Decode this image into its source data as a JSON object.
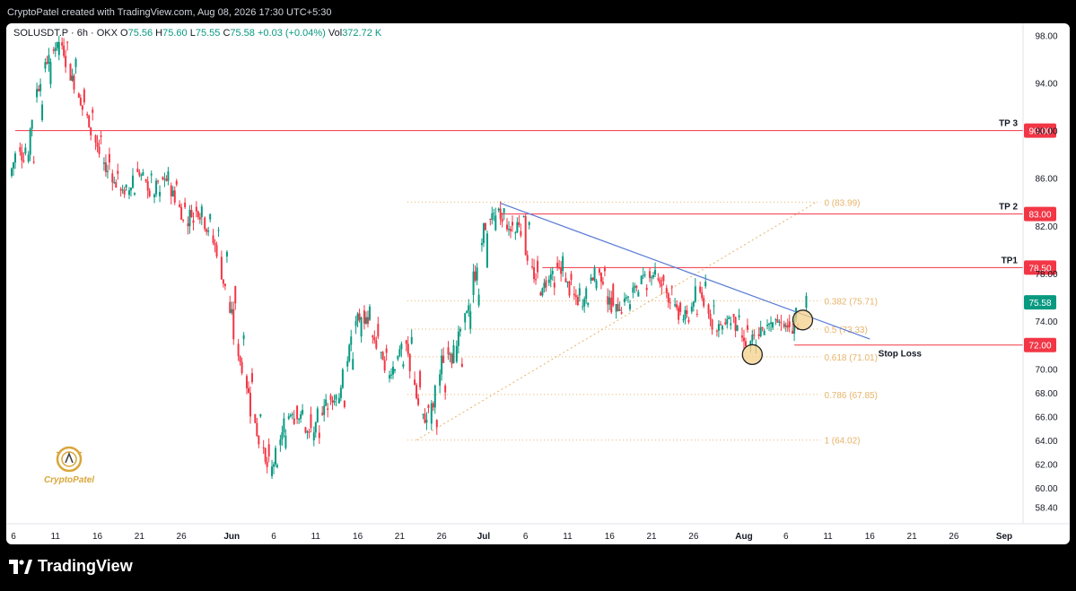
{
  "header": {
    "credit": "CryptoPatel created with TradingView.com, Aug 08, 2026 17:30 UTC+5:30"
  },
  "legend": {
    "symbol": "SOLUSDT.P · 6h · OKX",
    "open_label": "O",
    "open": "75.56",
    "high_label": "H",
    "high": "75.60",
    "low_label": "L",
    "low": "75.55",
    "close_label": "C",
    "close": "75.58",
    "change": "+0.03 (+0.04%)",
    "vol_label": "Vol",
    "vol": "372.72 K"
  },
  "watermark": {
    "text": "CryptoPatel"
  },
  "footer": {
    "brand": "TradingView"
  },
  "colors": {
    "up": "#089981",
    "down": "#f23645",
    "level": "#f23645",
    "trendline": "#5b7bd5",
    "fib": "#e6b36a",
    "marker_fill": "#f5d08a",
    "marker_stroke": "#222222"
  },
  "chart_data": {
    "type": "candlestick",
    "ylim": [
      57,
      99
    ],
    "y_ticks": [
      "98.00",
      "94.00",
      "90.00",
      "86.00",
      "82.00",
      "78.00",
      "74.00",
      "70.00",
      "68.00",
      "66.00",
      "64.00",
      "62.00",
      "60.00",
      "58.40"
    ],
    "y_tick_values": [
      98,
      94,
      90,
      86,
      82,
      78,
      74,
      70,
      68,
      66,
      64,
      62,
      60,
      58.4
    ],
    "x_ticks": [
      "6",
      "11",
      "16",
      "21",
      "26",
      "Jun",
      "6",
      "11",
      "16",
      "21",
      "26",
      "Jul",
      "6",
      "11",
      "16",
      "21",
      "26",
      "Aug",
      "6",
      "11",
      "16",
      "21",
      "26",
      "Sep"
    ],
    "x_start": "2026-05-06",
    "x_end": "2026-09-01",
    "last_price": "75.58",
    "levels": [
      {
        "label": "TP 3",
        "value": 90.0,
        "tag": "90.00"
      },
      {
        "label": "TP 2",
        "value": 83.0,
        "tag": "83.00"
      },
      {
        "label": "TP1",
        "value": 78.5,
        "tag": "78.50"
      },
      {
        "label": "Stop Loss",
        "value": 72.0,
        "tag": "72.00"
      }
    ],
    "fib": [
      {
        "ratio": "0",
        "price": "83.99",
        "label": "0 (83.99)",
        "value": 83.99
      },
      {
        "ratio": "0.382",
        "price": "75.71",
        "label": "0.382 (75.71)",
        "value": 75.71
      },
      {
        "ratio": "0.5",
        "price": "73.33",
        "label": "0.5 (73.33)",
        "value": 73.33
      },
      {
        "ratio": "0.618",
        "price": "71.01",
        "label": "0.618 (71.01)",
        "value": 71.01
      },
      {
        "ratio": "0.786",
        "price": "67.85",
        "label": "0.786 (67.85)",
        "value": 67.85
      },
      {
        "ratio": "1",
        "price": "64.02",
        "label": "1 (64.02)",
        "value": 64.02
      }
    ],
    "fib_range": {
      "from_date": "2026-06-23",
      "to_date": "2026-08-08",
      "low": 64.02,
      "high": 83.99
    },
    "trendline": {
      "from_date": "2026-07-03",
      "from_value": 83.9,
      "to_date": "2026-08-16",
      "to_value": 72.5
    },
    "markers": [
      {
        "date": "2026-08-02",
        "value": 71.2
      },
      {
        "date": "2026-08-08",
        "value": 74.1
      }
    ],
    "series_daily_close": [
      {
        "date": "2026-05-06",
        "value": 86.2
      },
      {
        "date": "2026-05-07",
        "value": 88.6
      },
      {
        "date": "2026-05-08",
        "value": 87.4
      },
      {
        "date": "2026-05-09",
        "value": 92.8
      },
      {
        "date": "2026-05-10",
        "value": 95.2
      },
      {
        "date": "2026-05-11",
        "value": 96.8
      },
      {
        "date": "2026-05-12",
        "value": 97.4
      },
      {
        "date": "2026-05-13",
        "value": 95.6
      },
      {
        "date": "2026-05-14",
        "value": 93.1
      },
      {
        "date": "2026-05-15",
        "value": 91.4
      },
      {
        "date": "2026-05-16",
        "value": 89.6
      },
      {
        "date": "2026-05-17",
        "value": 87.2
      },
      {
        "date": "2026-05-18",
        "value": 86.4
      },
      {
        "date": "2026-05-19",
        "value": 85.1
      },
      {
        "date": "2026-05-20",
        "value": 84.6
      },
      {
        "date": "2026-05-21",
        "value": 86.8
      },
      {
        "date": "2026-05-22",
        "value": 85.9
      },
      {
        "date": "2026-05-23",
        "value": 84.4
      },
      {
        "date": "2026-05-24",
        "value": 86.1
      },
      {
        "date": "2026-05-25",
        "value": 85.4
      },
      {
        "date": "2026-05-26",
        "value": 83.8
      },
      {
        "date": "2026-05-27",
        "value": 82.2
      },
      {
        "date": "2026-05-28",
        "value": 83.6
      },
      {
        "date": "2026-05-29",
        "value": 82.7
      },
      {
        "date": "2026-05-30",
        "value": 81.2
      },
      {
        "date": "2026-05-31",
        "value": 79.4
      },
      {
        "date": "2026-06-01",
        "value": 75.6
      },
      {
        "date": "2026-06-02",
        "value": 72.1
      },
      {
        "date": "2026-06-03",
        "value": 69.4
      },
      {
        "date": "2026-06-04",
        "value": 66.2
      },
      {
        "date": "2026-06-05",
        "value": 63.4
      },
      {
        "date": "2026-06-06",
        "value": 61.0
      },
      {
        "date": "2026-06-07",
        "value": 63.6
      },
      {
        "date": "2026-06-08",
        "value": 65.8
      },
      {
        "date": "2026-06-09",
        "value": 66.9
      },
      {
        "date": "2026-06-10",
        "value": 65.1
      },
      {
        "date": "2026-06-11",
        "value": 64.0
      },
      {
        "date": "2026-06-12",
        "value": 66.3
      },
      {
        "date": "2026-06-13",
        "value": 67.8
      },
      {
        "date": "2026-06-14",
        "value": 67.1
      },
      {
        "date": "2026-06-15",
        "value": 70.2
      },
      {
        "date": "2026-06-16",
        "value": 73.6
      },
      {
        "date": "2026-06-17",
        "value": 74.9
      },
      {
        "date": "2026-06-18",
        "value": 72.8
      },
      {
        "date": "2026-06-19",
        "value": 71.4
      },
      {
        "date": "2026-06-20",
        "value": 69.2
      },
      {
        "date": "2026-06-21",
        "value": 70.8
      },
      {
        "date": "2026-06-22",
        "value": 72.4
      },
      {
        "date": "2026-06-23",
        "value": 69.1
      },
      {
        "date": "2026-06-24",
        "value": 66.2
      },
      {
        "date": "2026-06-25",
        "value": 65.4
      },
      {
        "date": "2026-06-26",
        "value": 68.6
      },
      {
        "date": "2026-06-27",
        "value": 71.8
      },
      {
        "date": "2026-06-28",
        "value": 70.6
      },
      {
        "date": "2026-06-29",
        "value": 73.9
      },
      {
        "date": "2026-06-30",
        "value": 76.2
      },
      {
        "date": "2026-07-01",
        "value": 80.4
      },
      {
        "date": "2026-07-02",
        "value": 82.6
      },
      {
        "date": "2026-07-03",
        "value": 83.3
      },
      {
        "date": "2026-07-04",
        "value": 82.1
      },
      {
        "date": "2026-07-05",
        "value": 81.4
      },
      {
        "date": "2026-07-06",
        "value": 82.8
      },
      {
        "date": "2026-07-07",
        "value": 78.6
      },
      {
        "date": "2026-07-08",
        "value": 76.4
      },
      {
        "date": "2026-07-09",
        "value": 77.2
      },
      {
        "date": "2026-07-10",
        "value": 78.9
      },
      {
        "date": "2026-07-11",
        "value": 77.6
      },
      {
        "date": "2026-07-12",
        "value": 76.3
      },
      {
        "date": "2026-07-13",
        "value": 75.2
      },
      {
        "date": "2026-07-14",
        "value": 77.4
      },
      {
        "date": "2026-07-15",
        "value": 78.4
      },
      {
        "date": "2026-07-16",
        "value": 76.1
      },
      {
        "date": "2026-07-17",
        "value": 74.8
      },
      {
        "date": "2026-07-18",
        "value": 75.6
      },
      {
        "date": "2026-07-19",
        "value": 76.4
      },
      {
        "date": "2026-07-20",
        "value": 77.1
      },
      {
        "date": "2026-07-21",
        "value": 78.2
      },
      {
        "date": "2026-07-22",
        "value": 77.6
      },
      {
        "date": "2026-07-23",
        "value": 76.8
      },
      {
        "date": "2026-07-24",
        "value": 75.3
      },
      {
        "date": "2026-07-25",
        "value": 74.1
      },
      {
        "date": "2026-07-26",
        "value": 74.8
      },
      {
        "date": "2026-07-27",
        "value": 76.9
      },
      {
        "date": "2026-07-28",
        "value": 75.4
      },
      {
        "date": "2026-07-29",
        "value": 73.2
      },
      {
        "date": "2026-07-30",
        "value": 73.9
      },
      {
        "date": "2026-07-31",
        "value": 74.6
      },
      {
        "date": "2026-08-01",
        "value": 72.8
      },
      {
        "date": "2026-08-02",
        "value": 71.9
      },
      {
        "date": "2026-08-03",
        "value": 72.9
      },
      {
        "date": "2026-08-04",
        "value": 73.6
      },
      {
        "date": "2026-08-05",
        "value": 74.1
      },
      {
        "date": "2026-08-06",
        "value": 73.8
      },
      {
        "date": "2026-08-07",
        "value": 73.2
      },
      {
        "date": "2026-08-08",
        "value": 75.58
      }
    ]
  }
}
